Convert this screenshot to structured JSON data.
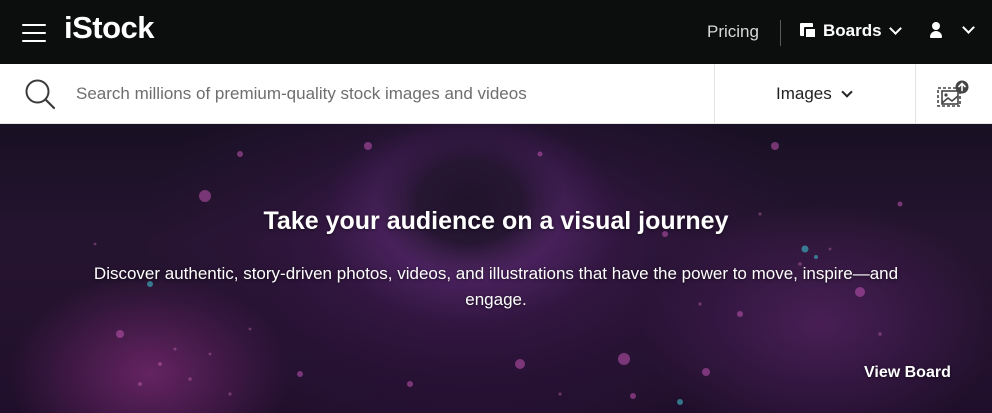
{
  "header": {
    "logo": "iStock",
    "pricing_label": "Pricing",
    "boards_label": "Boards",
    "icons": [
      "hamburger-menu-icon",
      "boards-icon",
      "chevron-down-icon",
      "user-icon"
    ]
  },
  "search": {
    "placeholder": "Search millions of premium-quality stock images and videos",
    "value": "",
    "media_type": "Images",
    "icons": [
      "search-icon",
      "visual-search-icon"
    ]
  },
  "hero": {
    "title": "Take your audience on a visual journey",
    "subtitle": "Discover authentic, story-driven photos, videos, and illustrations that have the power to move, inspire—and engage.",
    "cta_label": "View Board"
  },
  "colors": {
    "topbar_bg": "#0c0d0d",
    "searchbar_bg": "#ffffff",
    "hero_accent": "#c23fb6",
    "hero_teal": "#3fd0e0"
  }
}
